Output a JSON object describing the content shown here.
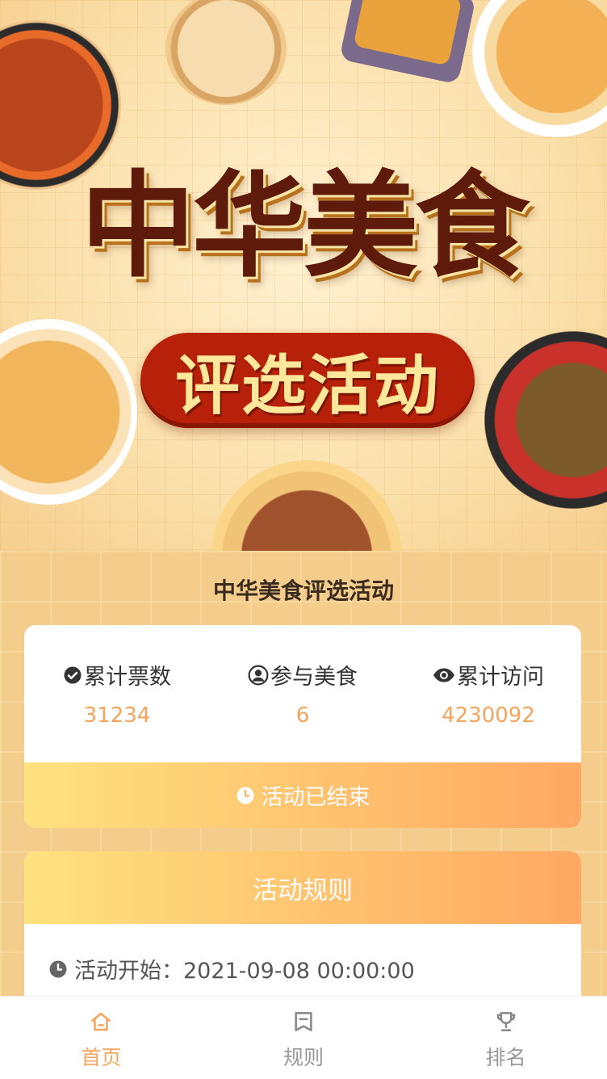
{
  "hero": {
    "title": "中华美食",
    "subtitle": "评选活动"
  },
  "page_title": "中华美食评选活动",
  "stats": [
    {
      "icon": "check-circle-icon",
      "label": "累计票数",
      "value": "31234"
    },
    {
      "icon": "user-circle-icon",
      "label": "参与美食",
      "value": "6"
    },
    {
      "icon": "eye-icon",
      "label": "累计访问",
      "value": "4230092"
    }
  ],
  "status": {
    "icon": "clock-icon",
    "text": "活动已结束"
  },
  "rules": {
    "header": "活动规则",
    "start": {
      "icon": "clock-icon",
      "text": "活动开始：2021-09-08 00:00:00"
    }
  },
  "tabbar": {
    "items": [
      {
        "label": "首页",
        "icon": "home-icon",
        "active": true
      },
      {
        "label": "规则",
        "icon": "bookmark-icon",
        "active": false
      },
      {
        "label": "排名",
        "icon": "trophy-icon",
        "active": false
      }
    ]
  },
  "colors": {
    "accent": "#f4a45b",
    "gradient_start": "#fee27f",
    "gradient_end": "#ffa862",
    "title_brown": "#5e1a0a",
    "pill_red": "#b82109"
  }
}
